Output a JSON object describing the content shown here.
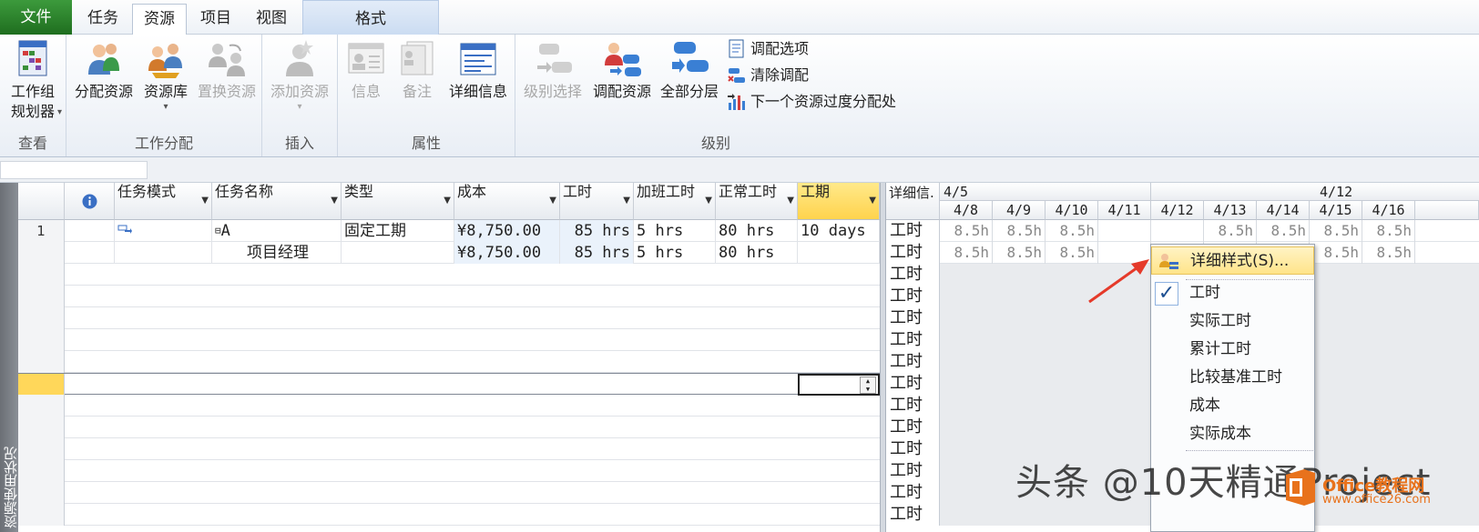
{
  "tabs": [
    {
      "label": "文件"
    },
    {
      "label": "任务"
    },
    {
      "label": "资源"
    },
    {
      "label": "项目"
    },
    {
      "label": "视图"
    },
    {
      "label": "格式"
    }
  ],
  "ribbon": {
    "view_group": {
      "label": "查看",
      "team_planner": "工作组\n规划器"
    },
    "assign_group": {
      "label": "工作分配",
      "assign": "分配资源",
      "pool": "资源库",
      "replace": "置换资源"
    },
    "insert_group": {
      "label": "插入",
      "add": "添加资源"
    },
    "props_group": {
      "label": "属性",
      "info": "信息",
      "notes": "备注",
      "details": "详细信息"
    },
    "level_group": {
      "label": "级别",
      "select": "级别选择",
      "resource": "调配资源",
      "all": "全部分层",
      "options": "调配选项",
      "clear": "清除调配",
      "next": "下一个资源过度分配处"
    }
  },
  "viewbar": {
    "label": "资源使用状况"
  },
  "grid": {
    "headers": [
      "任务模式",
      "任务名称",
      "类型",
      "成本",
      "工时",
      "加班工时",
      "正常工时",
      "工期"
    ],
    "rows": [
      {
        "num": "1",
        "name": "A",
        "type": "固定工期",
        "cost": "¥8,750.00",
        "work": "85 hrs",
        "ot": "5 hrs",
        "reg": "80 hrs",
        "dur": "10 days"
      },
      {
        "num": "",
        "name": "项目经理",
        "type": "",
        "cost": "¥8,750.00",
        "work": "85 hrs",
        "ot": "5 hrs",
        "reg": "80 hrs",
        "dur": ""
      }
    ]
  },
  "timescale": {
    "detail_header": "详细信.",
    "weeks": [
      "4/5",
      "4/12"
    ],
    "days": [
      "4/8",
      "4/9",
      "4/10",
      "4/11",
      "4/12",
      "4/13",
      "4/14",
      "4/15",
      "4/16"
    ],
    "row_label": "工时",
    "row1": [
      "8.5h",
      "8.5h",
      "8.5h",
      "",
      "",
      "8.5h",
      "8.5h",
      "8.5h",
      "8.5h"
    ],
    "row2": [
      "8.5h",
      "8.5h",
      "8.5h",
      "",
      "",
      "",
      "",
      "8.5h",
      "8.5h"
    ]
  },
  "context_menu": {
    "items": [
      "详细样式(S)...",
      "工时",
      "实际工时",
      "累计工时",
      "比较基准工时",
      "成本",
      "实际成本"
    ]
  },
  "watermark": {
    "text": "头条 @10天精通Project",
    "logo": "Office教程网",
    "url": "www.office26.com"
  }
}
